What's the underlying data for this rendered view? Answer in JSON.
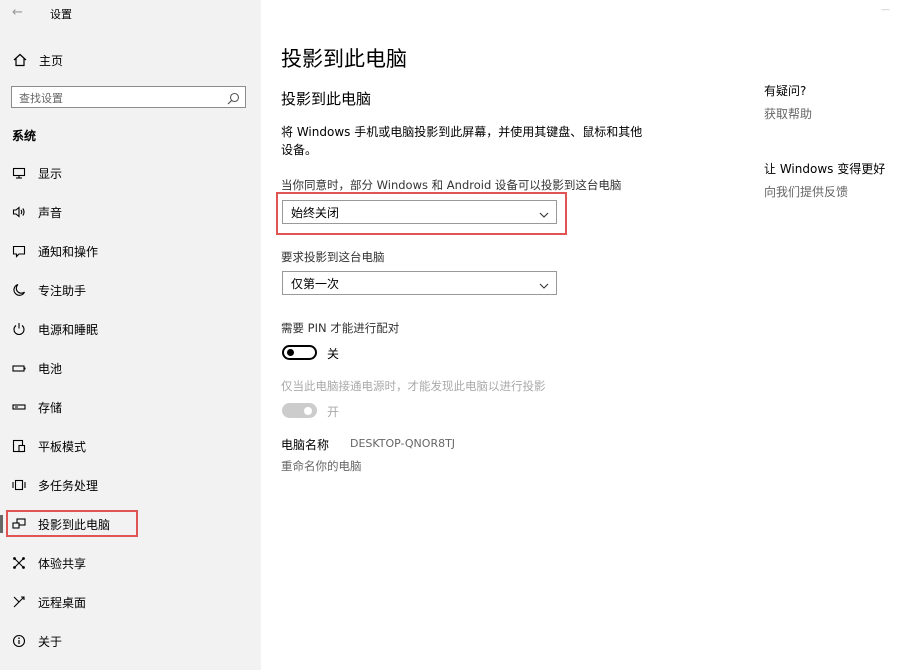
{
  "window": {
    "title": "设置",
    "back_icon": "back-arrow-icon",
    "minimize_glyph": "—"
  },
  "sidebar": {
    "home_label": "主页",
    "search_placeholder": "查找设置",
    "section_label": "系统",
    "items": [
      {
        "label": "显示",
        "icon": "monitor-icon"
      },
      {
        "label": "声音",
        "icon": "speaker-icon"
      },
      {
        "label": "通知和操作",
        "icon": "notification-icon"
      },
      {
        "label": "专注助手",
        "icon": "moon-icon"
      },
      {
        "label": "电源和睡眠",
        "icon": "power-icon"
      },
      {
        "label": "电池",
        "icon": "battery-icon"
      },
      {
        "label": "存储",
        "icon": "storage-icon"
      },
      {
        "label": "平板模式",
        "icon": "tablet-icon"
      },
      {
        "label": "多任务处理",
        "icon": "multitask-icon"
      },
      {
        "label": "投影到此电脑",
        "icon": "project-icon",
        "active": true
      },
      {
        "label": "体验共享",
        "icon": "share-icon"
      },
      {
        "label": "远程桌面",
        "icon": "remote-desktop-icon"
      },
      {
        "label": "关于",
        "icon": "info-icon"
      }
    ]
  },
  "main": {
    "title": "投影到此电脑",
    "subtitle": "投影到此电脑",
    "description": "将 Windows 手机或电脑投影到此屏幕，并使用其键盘、鼠标和其他设备。",
    "availability_label": "当你同意时，部分 Windows 和 Android 设备可以投影到这台电脑",
    "availability_value": "始终关闭",
    "ask_label": "要求投影到这台电脑",
    "ask_value": "仅第一次",
    "pin_label": "需要 PIN 才能进行配对",
    "pin_toggle_state": "关",
    "power_label": "仅当此电脑接通电源时，才能发现此电脑以进行投影",
    "power_toggle_state": "开",
    "pc_name_label": "电脑名称",
    "pc_name_value": "DESKTOP-QNOR8TJ",
    "rename_link": "重命名你的电脑"
  },
  "help": {
    "question_heading": "有疑问?",
    "get_help_link": "获取帮助",
    "improve_heading": "让 Windows 变得更好",
    "feedback_link": "向我们提供反馈"
  },
  "colors": {
    "highlight_box": "#e05454",
    "sidebar_bg": "#f2f2f2",
    "active_indicator": "#666666"
  }
}
